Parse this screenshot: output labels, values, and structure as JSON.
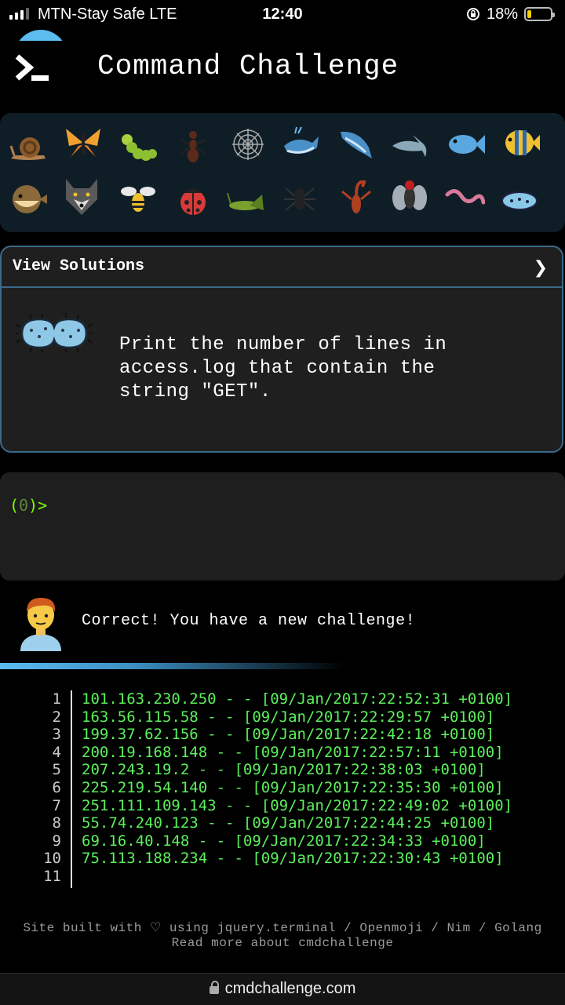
{
  "status_bar": {
    "carrier": "MTN-Stay Safe  LTE",
    "time": "12:40",
    "battery_percent": "18%",
    "battery_level": 0.18
  },
  "header": {
    "title": "Command Challenge"
  },
  "emoji_grid": {
    "row1": [
      "snail-icon",
      "butterfly-icon",
      "caterpillar-icon",
      "ant-icon",
      "spider-web-icon",
      "whale-icon",
      "spouting-whale-icon",
      "dolphin-icon",
      "fish-icon",
      "tropical-fish-icon"
    ],
    "row2": [
      "blowfish-icon",
      "wolf-icon",
      "honeybee-icon",
      "lady-beetle-icon",
      "cricket-icon",
      "spider-icon",
      "scorpion-icon",
      "fly-icon",
      "worm-icon",
      "microbe-icon"
    ]
  },
  "challenge": {
    "header_label": "View Solutions",
    "chevron": "❯",
    "task": "Print the number of lines in access.log that contain the string \"GET\"."
  },
  "terminal": {
    "prompt_open": "(",
    "prompt_count": "0",
    "prompt_close": ")>"
  },
  "feedback": {
    "message": "Correct! You have a new challenge!"
  },
  "output": {
    "lines": [
      {
        "n": "1",
        "text": "101.163.230.250 - - [09/Jan/2017:22:52:31 +0100]"
      },
      {
        "n": "2",
        "text": "163.56.115.58 - - [09/Jan/2017:22:29:57 +0100]"
      },
      {
        "n": "3",
        "text": "199.37.62.156 - - [09/Jan/2017:22:42:18 +0100]"
      },
      {
        "n": "4",
        "text": "200.19.168.148 - - [09/Jan/2017:22:57:11 +0100]"
      },
      {
        "n": "5",
        "text": "207.243.19.2 - - [09/Jan/2017:22:38:03 +0100]"
      },
      {
        "n": "6",
        "text": "225.219.54.140 - - [09/Jan/2017:22:35:30 +0100]"
      },
      {
        "n": "7",
        "text": "251.111.109.143 - - [09/Jan/2017:22:49:02 +0100]"
      },
      {
        "n": "8",
        "text": "55.74.240.123 - - [09/Jan/2017:22:44:25 +0100]"
      },
      {
        "n": "9",
        "text": "69.16.40.148 - - [09/Jan/2017:22:34:33 +0100]"
      },
      {
        "n": "10",
        "text": "75.113.188.234 - - [09/Jan/2017:22:30:43 +0100]"
      },
      {
        "n": "11",
        "text": ""
      }
    ]
  },
  "footer": {
    "line1": "Site built with ♡ using jquery.terminal / Openmoji / Nim / Golang",
    "line2": "Read more about cmdchallenge"
  },
  "browser": {
    "url": "cmdchallenge.com"
  },
  "colors": {
    "accent": "#5bbcf0",
    "border": "#3a6a8a",
    "output_green": "#5cf05c",
    "prompt_green": "#7fff00",
    "emoji_panel_bg": "#0f1d26"
  }
}
